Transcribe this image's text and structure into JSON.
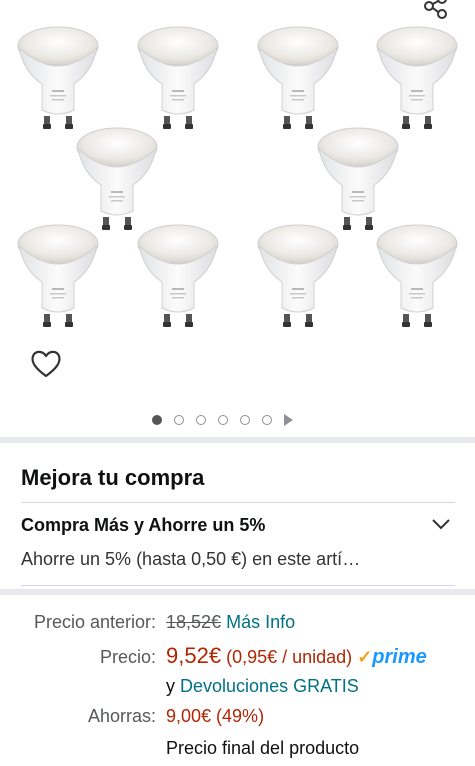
{
  "gallery": {
    "share_icon": "share-icon",
    "heart_icon": "heart-outline-icon",
    "image_count": 12,
    "carousel": {
      "dot_count": 6,
      "active_index": 0,
      "video_icon": "play-icon"
    }
  },
  "upgrade": {
    "title": "Mejora tu compra"
  },
  "promo": {
    "title": "Compra Más y Ahorre un 5%",
    "subtitle": "Ahorre un 5% (hasta 0,50 €) en este artí…",
    "chevron_icon": "chevron-down-icon"
  },
  "pricing": {
    "previous_label": "Precio anterior:",
    "previous_value": "18,52€",
    "more_info": "Más Info",
    "price_label": "Precio:",
    "price_value": "9,52€",
    "unit_price": "(0,95€ / unidad)",
    "prime_check": "✓",
    "prime_word": "prime",
    "and": "y",
    "returns_link": "Devoluciones GRATIS",
    "savings_label": "Ahorras:",
    "savings_value": "9,00€ (49%)",
    "final_note": "Precio final del producto"
  },
  "colors": {
    "price_red": "#b12704",
    "link_teal": "#007185",
    "prime_blue": "#1a98ff",
    "prime_orange": "#f7a31c"
  }
}
